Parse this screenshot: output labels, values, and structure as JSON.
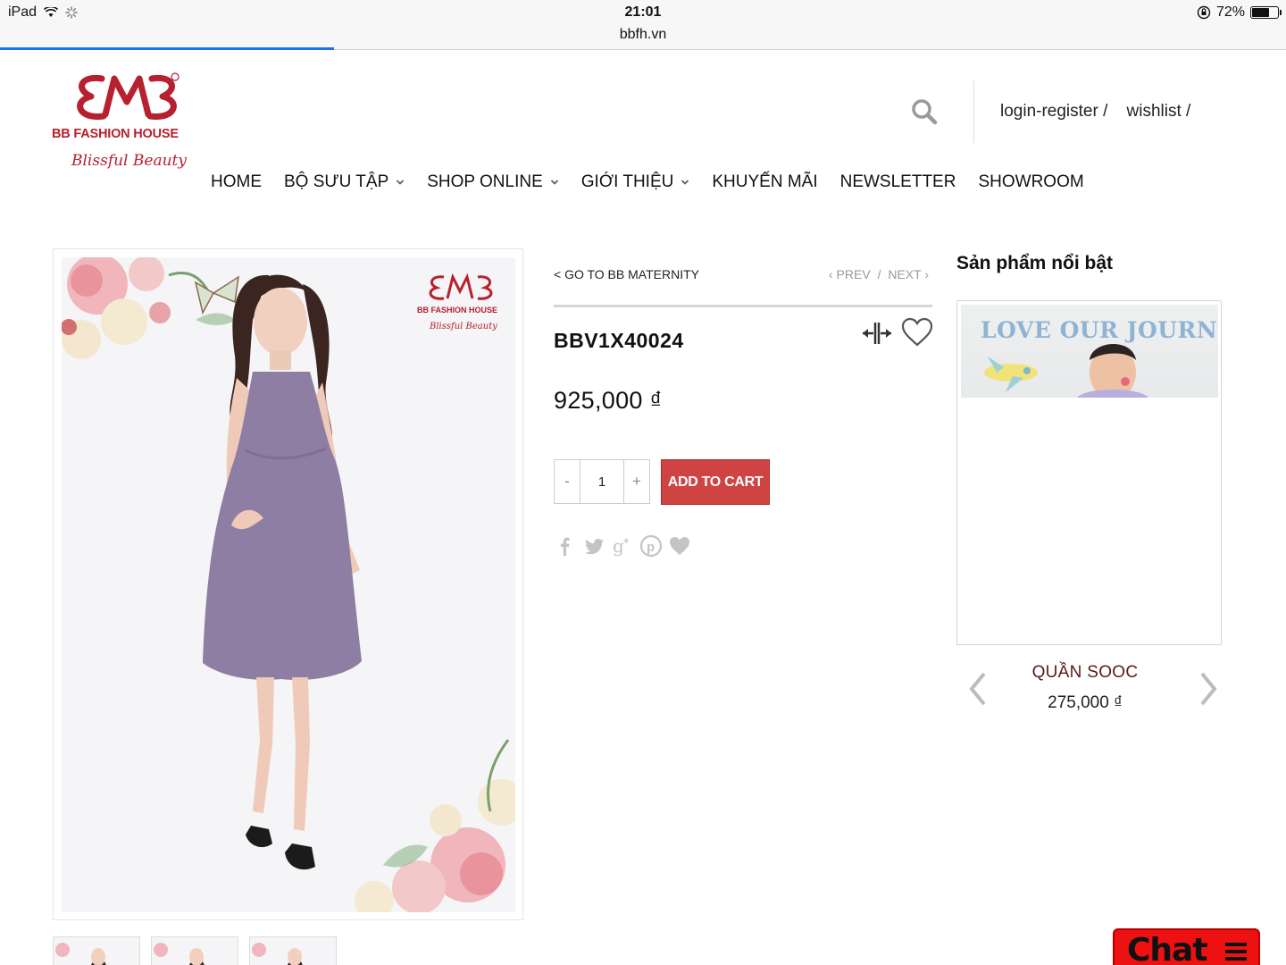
{
  "statusbar": {
    "device": "iPad",
    "time": "21:01",
    "battery_text": "72%",
    "battery_level": 0.72
  },
  "browser": {
    "url": "bbfh.vn",
    "load_progress": 0.26
  },
  "brand": {
    "name": "BB FASHION HOUSE",
    "tagline": "Blissful Beauty",
    "color": "#b7202e"
  },
  "header": {
    "login_register": "login-register /",
    "wishlist": "wishlist /"
  },
  "nav": {
    "items": [
      {
        "label": "HOME",
        "has_dropdown": false
      },
      {
        "label": "BỘ SƯU TẬP",
        "has_dropdown": true
      },
      {
        "label": "SHOP ONLINE",
        "has_dropdown": true
      },
      {
        "label": "GIỚI THIỆU",
        "has_dropdown": true
      },
      {
        "label": "KHUYẾN MÃI",
        "has_dropdown": false
      },
      {
        "label": "NEWSLETTER",
        "has_dropdown": false
      },
      {
        "label": "SHOWROOM",
        "has_dropdown": false
      }
    ]
  },
  "product": {
    "breadcrumb": "< GO TO BB MATERNITY",
    "prev": "‹ PREV",
    "separator": "/",
    "next": "NEXT ›",
    "sku": "BBV1X40024",
    "price": "925,000 ₫",
    "quantity": "1",
    "qty_minus": "-",
    "qty_plus": "+",
    "add_to_cart": "ADD TO CART",
    "accent": "#d04343"
  },
  "featured": {
    "title": "Sản phẩm nổi bật",
    "banner_text": "LOVE OUR JOURNEY",
    "item_name": "QUẦN SOOC",
    "item_price": "275,000 ₫"
  },
  "chat": {
    "label": "Chat",
    "color": "#ee1111"
  }
}
